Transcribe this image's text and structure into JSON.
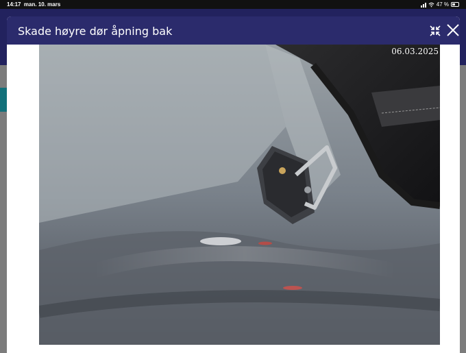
{
  "status_bar": {
    "time": "14:17",
    "date": "man. 10. mars",
    "battery": "47 %"
  },
  "modal": {
    "title": "Skade høyre dør åpning bak",
    "collapse_icon": "collapse-icon",
    "close_icon": "close-icon"
  },
  "photo": {
    "date_stamp": "06.03.2025"
  },
  "colors": {
    "header": "#2b2b6c",
    "background_header": "#22225e",
    "accent": "#12707a"
  }
}
